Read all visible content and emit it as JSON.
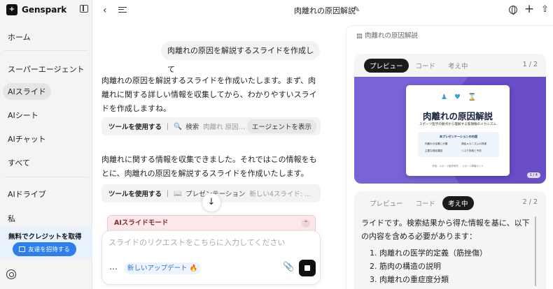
{
  "app": {
    "name": "Genspark",
    "logo_glyph": "+"
  },
  "sidebar": {
    "items": [
      {
        "label": "ホーム",
        "active": false
      },
      {
        "label": "スーパーエージェント",
        "active": false
      },
      {
        "label": "AIスライド",
        "active": true
      },
      {
        "label": "AIシート",
        "active": false
      },
      {
        "label": "AIチャット",
        "active": false
      },
      {
        "label": "すべて",
        "active": false
      },
      {
        "label": "AIドライブ",
        "active": false
      },
      {
        "label": "私",
        "active": false
      }
    ],
    "promo": {
      "title": "無料でクレジットを取得",
      "button": "友達を招待する"
    }
  },
  "header": {
    "title": "肉離れの原因解説"
  },
  "chat": {
    "user_message": "肉離れの原因を解説するスライドを作成して",
    "ai_message_1": "肉離れの原因を解説するスライドを作成いたします。まず、肉離れに関する詳しい情報を収集してから、わかりやすいスライドを作成しますね。",
    "tool_1": {
      "label": "ツールを使用する",
      "sep": "|",
      "icon": "🔍",
      "name": "検索",
      "detail": "肉離れ 原因 メ…",
      "button": "エージェントを表示"
    },
    "ai_message_2": "肉離れに関する情報を収集できました。それではこの情報をもとに、肉離れの原因を解説するスライドを作成いたします。",
    "tool_2": {
      "label": "ツールを使用する",
      "sep": "|",
      "icon": "📖",
      "name": "プレゼンテーション",
      "detail": "新しい4スライド: 肉離…"
    },
    "mode_bar": "AIスライドモード",
    "input": {
      "placeholder": "スライドのリクエストをこちらに入力してください",
      "value": ""
    },
    "update_chip": "新しいアップデート 🔥"
  },
  "panel": {
    "header": "肉離れの原因解説",
    "card1": {
      "tabs": [
        "プレビュー",
        "コード",
        "考え中"
      ],
      "active_tab": 0,
      "page": "1 / 2",
      "slide": {
        "title": "肉離れの原因解説",
        "subtitle": "スポーツ医学の観点から理解する筋損傷のメカニズム",
        "box_title": "本プレゼンテーションの内容",
        "box_items": [
          "肉離れの定義と分類",
          "発症メカニズムの詳細",
          "主要な発症要因",
          "リスク評価と予防"
        ],
        "footer": "作成：スポーツ医学研究 ｜ スポーツ障害ガイド",
        "badge": "1 / 4"
      }
    },
    "card2": {
      "tabs": [
        "プレビュー",
        "コード",
        "考え中"
      ],
      "active_tab": 2,
      "page": "2 / 2",
      "text": "ライドです。検索結果から得た情報を基に、以下の内容を含める必要があります：",
      "list": [
        "1. 肉離れの医学的定義（筋挫傷）",
        "2. 筋肉の構造の説明",
        "3. 肉離れの重症度分類"
      ]
    }
  },
  "colors": {
    "accent": "#2d7ff0",
    "slide_bg": "#7a63d6",
    "mode_bar": "#fbe8ea"
  }
}
